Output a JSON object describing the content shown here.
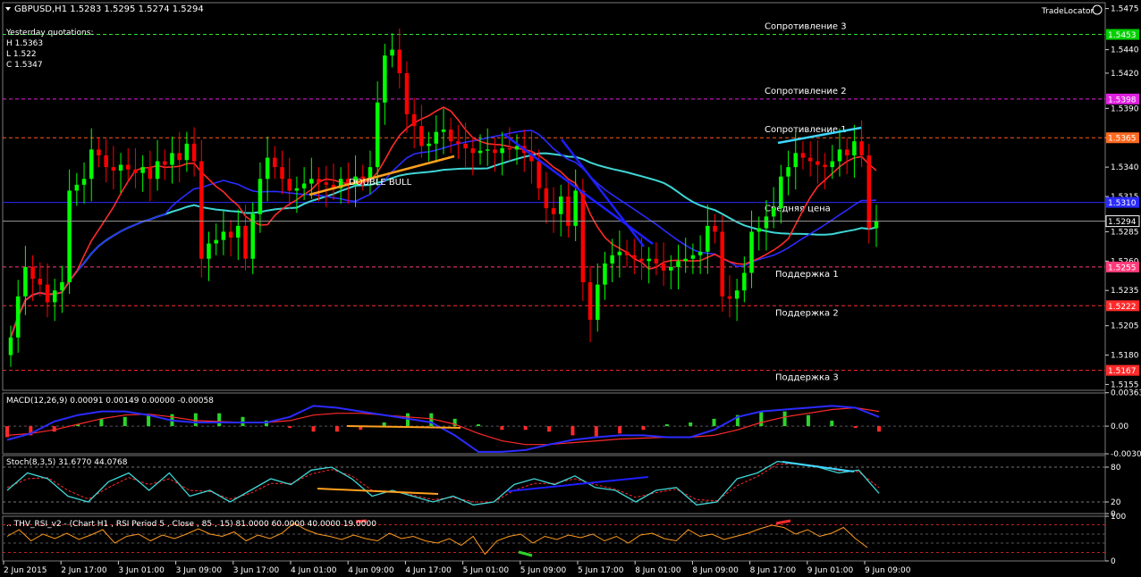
{
  "header": {
    "symbol": "GBPUSD,H1",
    "ohlc": "1.5283 1.5295 1.5274 1.5294",
    "tradelocator": "TradeLocator"
  },
  "yesterday": {
    "title": "Yesterday quotations:",
    "h": "H 1.5363",
    "l": "L 1.522",
    "c": "C 1.5347"
  },
  "colors": {
    "bull": "#00ff00",
    "bear": "#ff0000",
    "ma_fast": "#ff2a2a",
    "ma_mid": "#2b2bff",
    "ma_slow": "#3fd6d6",
    "grid": "#3a3a3a"
  },
  "chart_data": [
    {
      "type": "candlestick",
      "symbol": "GBPUSD",
      "timeframe": "H1",
      "ylim": [
        1.515,
        1.548
      ],
      "price_ticks": [
        "1.5475",
        "1.5440",
        "1.5420",
        "1.5390",
        "1.5365",
        "1.5340",
        "1.5315",
        "1.5285",
        "1.5260",
        "1.5235",
        "1.5205",
        "1.5180",
        "1.5155"
      ],
      "x_ticks": [
        "2 Jun 2015",
        "2 Jun 17:00",
        "3 Jun 01:00",
        "3 Jun 09:00",
        "3 Jun 17:00",
        "4 Jun 01:00",
        "4 Jun 09:00",
        "4 Jun 17:00",
        "5 Jun 01:00",
        "5 Jun 09:00",
        "5 Jun 17:00",
        "8 Jun 01:00",
        "8 Jun 09:00",
        "8 Jun 17:00",
        "9 Jun 01:00",
        "9 Jun 09:00"
      ],
      "levels": [
        {
          "label": "Сопротивление 3",
          "value": "1.5453",
          "price": 1.5453,
          "color": "#2ee02e",
          "tag_bg": "#00d000",
          "tag_fg": "#000000"
        },
        {
          "label": "Сопротивление 2",
          "value": "1.5398",
          "price": 1.5398,
          "color": "#e020e0",
          "tag_bg": "#e020e0",
          "tag_fg": "#000000"
        },
        {
          "label": "Сопротивление 1",
          "value": "1.5365",
          "price": 1.5365,
          "color": "#ff5a1e",
          "tag_bg": "#ff6a20",
          "tag_fg": "#000000"
        },
        {
          "label": "Средняя цена",
          "value": "1.5310",
          "price": 1.531,
          "color": "#2b2bff",
          "tag_bg": "#2b2bff",
          "tag_fg": "#000000"
        },
        {
          "label": "Поддержка 1",
          "value": "1.5255",
          "price": 1.5255,
          "color": "#ff3b7a",
          "tag_bg": "#ff3b7a",
          "tag_fg": "#000000"
        },
        {
          "label": "Поддержка 2",
          "value": "1.5222",
          "price": 1.5222,
          "color": "#ff2a2a",
          "tag_bg": "#ff2a2a",
          "tag_fg": "#000000"
        },
        {
          "label": "Поддержка 3",
          "value": "1.5167",
          "price": 1.5167,
          "color": "#ff2a2a",
          "tag_bg": "#ff2a2a",
          "tag_fg": "#000000"
        }
      ],
      "current_price": "1.5294",
      "annotation": "DOUBLE  BULL",
      "closes": [
        1.5195,
        1.523,
        1.5255,
        1.5245,
        1.524,
        1.5225,
        1.5235,
        1.5242,
        1.532,
        1.5325,
        1.533,
        1.5355,
        1.535,
        1.534,
        1.5337,
        1.5342,
        1.5338,
        1.5335,
        1.534,
        1.533,
        1.5345,
        1.5342,
        1.5352,
        1.5346,
        1.536,
        1.5345,
        1.5262,
        1.5275,
        1.5278,
        1.5285,
        1.528,
        1.529,
        1.5262,
        1.53,
        1.533,
        1.5348,
        1.534,
        1.533,
        1.532,
        1.5322,
        1.5326,
        1.533,
        1.5327,
        1.5325,
        1.5322,
        1.533,
        1.5325,
        1.5332,
        1.533,
        1.534,
        1.5395,
        1.5435,
        1.544,
        1.542,
        1.5385,
        1.5375,
        1.5358,
        1.536,
        1.537,
        1.5372,
        1.5362,
        1.536,
        1.5356,
        1.5352,
        1.5354,
        1.5355,
        1.5352,
        1.5356,
        1.5355,
        1.5358,
        1.5352,
        1.5345,
        1.5322,
        1.5305,
        1.53,
        1.5315,
        1.529,
        1.532,
        1.5242,
        1.521,
        1.524,
        1.5258,
        1.5265,
        1.5268,
        1.5265,
        1.5262,
        1.526,
        1.5262,
        1.5258,
        1.5252,
        1.5255,
        1.526,
        1.5262,
        1.5265,
        1.5268,
        1.529,
        1.5285,
        1.523,
        1.5228,
        1.5235,
        1.525,
        1.5285,
        1.5288,
        1.5298,
        1.5305,
        1.5332,
        1.534,
        1.5352,
        1.5348,
        1.5345,
        1.5342,
        1.534,
        1.5345,
        1.5355,
        1.535,
        1.5362,
        1.535,
        1.5288,
        1.5294
      ]
    },
    {
      "type": "line",
      "indicator": "MACD(12,26,9)",
      "title": "MACD(12,26,9) 0.00091 0.00149 0.00000 -0.00058",
      "y_ticks": [
        "0.00363",
        "0.00",
        "-0.00301"
      ],
      "ylim": [
        -0.003,
        0.0036
      ],
      "histogram": [
        -0.0012,
        -0.001,
        -0.0006,
        0.0002,
        0.0008,
        0.001,
        0.0012,
        0.0013,
        0.0014,
        0.0014,
        0.001,
        0.0006,
        -0.0002,
        -0.0006,
        -0.0006,
        -0.0004,
        0.0004,
        0.0014,
        0.0014,
        0.0008,
        0.0002,
        -0.0004,
        -0.0004,
        -0.0006,
        -0.001,
        -0.0012,
        -0.0008,
        -0.0004,
        0.0002,
        0.0004,
        0.0008,
        0.0012,
        0.0016,
        0.0016,
        0.0012,
        0.0006,
        -0.0002,
        -0.0006
      ],
      "macd": [
        -0.0015,
        -0.0008,
        0.0005,
        0.0012,
        0.0016,
        0.0016,
        0.0012,
        0.0006,
        0.0004,
        0.0004,
        0.0004,
        0.0004,
        0.001,
        0.0022,
        0.002,
        0.0016,
        0.0012,
        0.0008,
        0.0004,
        -0.001,
        -0.0028,
        -0.0028,
        -0.0026,
        -0.002,
        -0.0015,
        -0.0012,
        -0.001,
        -0.001,
        -0.0012,
        -0.0012,
        -0.0004,
        0.001,
        0.0016,
        0.0018,
        0.002,
        0.0022,
        0.002,
        0.001
      ],
      "signal": [
        -0.001,
        -0.0008,
        -0.0004,
        0.0002,
        0.0008,
        0.0012,
        0.0013,
        0.001,
        0.0006,
        0.0005,
        0.0004,
        0.0004,
        0.0006,
        0.0012,
        0.0014,
        0.0014,
        0.0012,
        0.001,
        0.0008,
        0.0002,
        -0.0008,
        -0.0016,
        -0.002,
        -0.002,
        -0.0018,
        -0.0016,
        -0.0014,
        -0.0013,
        -0.0012,
        -0.0012,
        -0.001,
        -0.0004,
        0.0004,
        0.001,
        0.0014,
        0.0018,
        0.002,
        0.0016
      ]
    },
    {
      "type": "line",
      "indicator": "Stoch(8,3,5)",
      "title": "Stoch(8,3,5) 31.6770 44.0768",
      "y_ticks": [
        "80",
        "20",
        "0"
      ],
      "ylim": [
        0,
        100
      ],
      "main": [
        40,
        70,
        60,
        30,
        20,
        55,
        70,
        40,
        70,
        30,
        40,
        20,
        40,
        60,
        50,
        75,
        80,
        60,
        30,
        40,
        30,
        20,
        30,
        15,
        20,
        50,
        60,
        50,
        65,
        45,
        40,
        20,
        40,
        45,
        15,
        20,
        60,
        70,
        90,
        85,
        80,
        70,
        75,
        35
      ],
      "signal": [
        45,
        60,
        62,
        40,
        25,
        45,
        62,
        50,
        60,
        40,
        38,
        25,
        35,
        52,
        52,
        68,
        76,
        65,
        40,
        38,
        32,
        24,
        28,
        20,
        20,
        40,
        52,
        52,
        60,
        50,
        42,
        28,
        36,
        42,
        24,
        22,
        48,
        64,
        85,
        86,
        82,
        74,
        72,
        45
      ]
    },
    {
      "type": "line",
      "indicator": "THV RSI_v2",
      "title": ".. THV_RSI_v2 - (Chart H1 , RSI Period 5 , Close , 85 , 15) 81.0000 60.0000 40.0000 19.0000",
      "y_ticks": [
        "100",
        "0"
      ],
      "ylim": [
        0,
        100
      ],
      "levels": [
        81,
        60,
        40,
        19
      ],
      "values": [
        55,
        70,
        45,
        60,
        50,
        62,
        48,
        58,
        70,
        40,
        55,
        60,
        45,
        58,
        50,
        60,
        72,
        60,
        55,
        65,
        45,
        58,
        50,
        62,
        85,
        70,
        60,
        55,
        48,
        58,
        50,
        45,
        62,
        50,
        55,
        45,
        40,
        50,
        35,
        55,
        15,
        45,
        55,
        60,
        40,
        55,
        48,
        58,
        52,
        60,
        45,
        55,
        40,
        58,
        62,
        50,
        45,
        70,
        55,
        60,
        48,
        55,
        62,
        72,
        80,
        75,
        60,
        70,
        55,
        62,
        75,
        50,
        30
      ]
    }
  ]
}
